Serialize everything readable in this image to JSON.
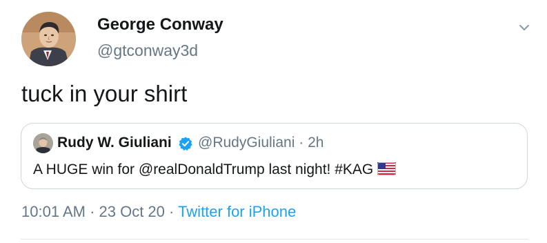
{
  "author": {
    "display_name": "George Conway",
    "handle": "@gtconway3d"
  },
  "tweet": {
    "text": "tuck in your shirt"
  },
  "quoted_tweet": {
    "display_name": "Rudy W. Giuliani",
    "handle": "@RudyGiuliani",
    "separator": " · ",
    "age": "2h",
    "text": "A HUGE win for @realDonaldTrump last night! #KAG",
    "verified": true,
    "emoji": "us-flag"
  },
  "meta": {
    "time": "10:01 AM",
    "separator": " · ",
    "date": "23 Oct 20",
    "source": "Twitter for iPhone"
  },
  "icons": {
    "menu": "chevron-down-icon",
    "verified": "verified-badge-icon"
  },
  "colors": {
    "link": "#1da1f2",
    "secondary_text": "#657786",
    "border": "#ccd6dd"
  }
}
